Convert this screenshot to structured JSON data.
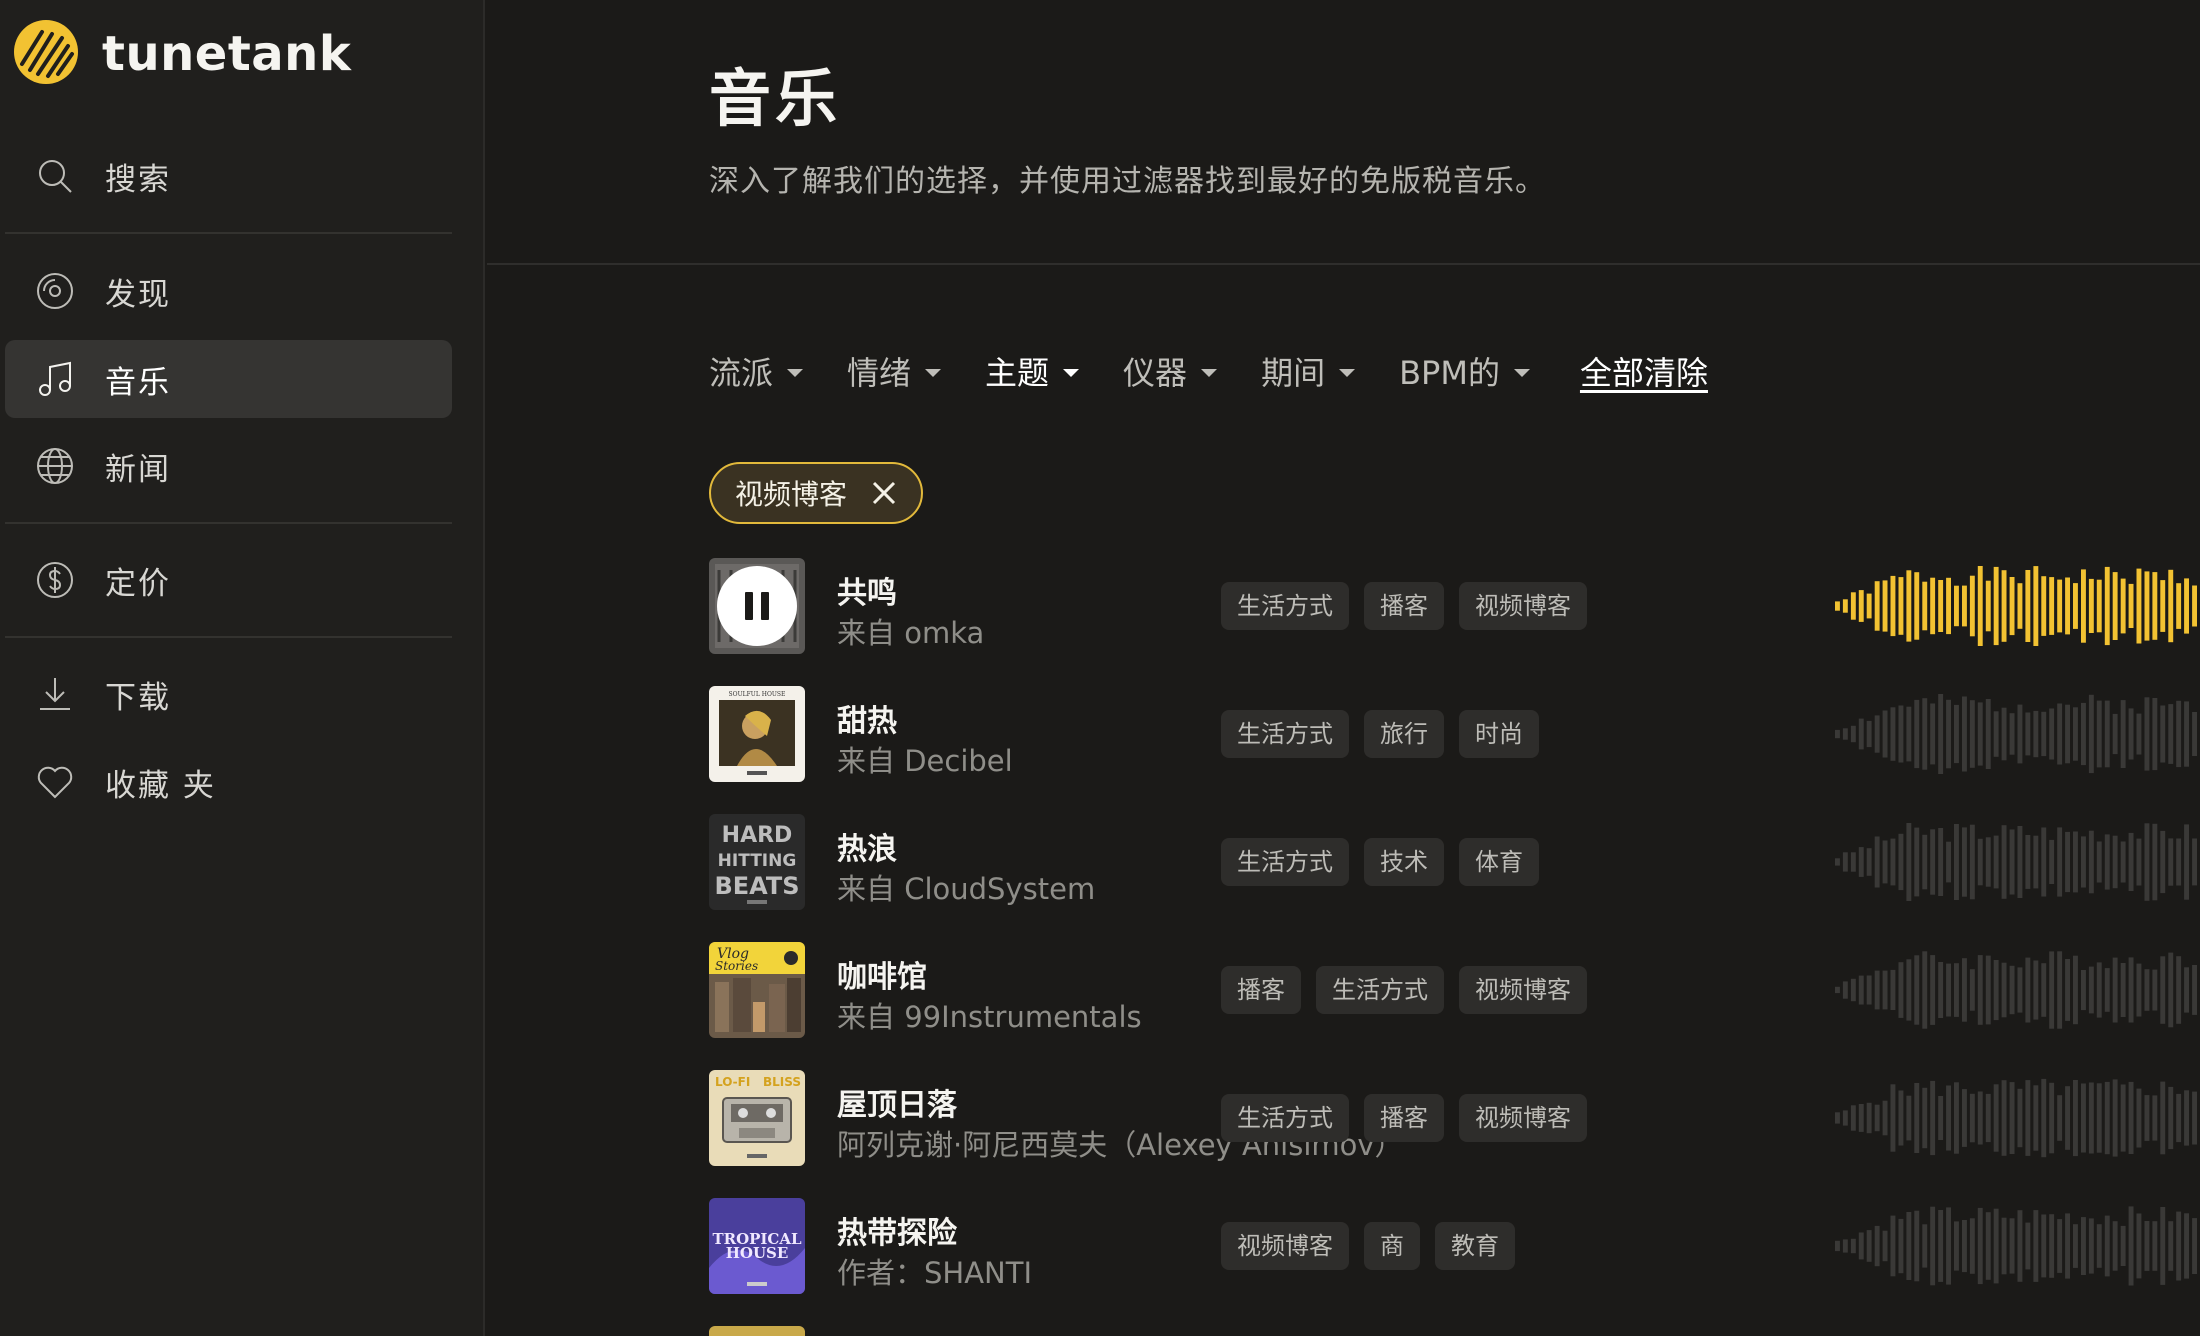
{
  "brand": {
    "name": "tunetank",
    "accent": "#f2c232"
  },
  "sidebar": {
    "items": [
      {
        "label": "搜索",
        "icon": "search-icon",
        "active": false
      },
      {
        "label": "发现",
        "icon": "disc-icon",
        "active": false
      },
      {
        "label": "音乐",
        "icon": "music-note-icon",
        "active": true
      },
      {
        "label": "新闻",
        "icon": "globe-icon",
        "active": false
      },
      {
        "label": "定价",
        "icon": "dollar-icon",
        "active": false
      },
      {
        "label": "下载",
        "icon": "download-icon",
        "active": false
      },
      {
        "label": "收藏 夹",
        "icon": "heart-icon",
        "active": false
      }
    ]
  },
  "header": {
    "title": "音乐",
    "subtitle": "深入了解我们的选择，并使用过滤器找到最好的免版税音乐。"
  },
  "filters": {
    "items": [
      {
        "label": "流派",
        "active": false
      },
      {
        "label": "情绪",
        "active": false
      },
      {
        "label": "主题",
        "active": true
      },
      {
        "label": "仪器",
        "active": false
      },
      {
        "label": "期间",
        "active": false
      },
      {
        "label": "BPM的",
        "active": false
      }
    ],
    "clear_all": "全部清除"
  },
  "active_filter_chip": {
    "label": "视频博客"
  },
  "tracks": [
    {
      "title": "共鸣",
      "artist": "来自 omka",
      "tags": [
        "生活方式",
        "播客",
        "视频博客"
      ],
      "playing": true
    },
    {
      "title": "甜热",
      "artist": "来自 Decibel",
      "tags": [
        "生活方式",
        "旅行",
        "时尚"
      ],
      "playing": false
    },
    {
      "title": "热浪",
      "artist": "来自 CloudSystem",
      "tags": [
        "生活方式",
        "技术",
        "体育"
      ],
      "playing": false
    },
    {
      "title": "咖啡馆",
      "artist": "来自 99Instrumentals",
      "tags": [
        "播客",
        "生活方式",
        "视频博客"
      ],
      "playing": false
    },
    {
      "title": "屋顶日落",
      "artist": "阿列克谢·阿尼西莫夫（Alexey Anisimov）",
      "tags": [
        "生活方式",
        "播客",
        "视频博客"
      ],
      "playing": false
    },
    {
      "title": "热带探险",
      "artist": "作者：SHANTI",
      "tags": [
        "视频博客",
        "商",
        "教育"
      ],
      "playing": false
    }
  ],
  "cover_art_text": {
    "track_2": "SOULFUL HOUSE",
    "track_3": [
      "HARD",
      "HITTING",
      "BEATS"
    ],
    "track_4": [
      "Vlog",
      "Stories"
    ],
    "track_5": [
      "LO-FI",
      "BLISS"
    ],
    "track_6": [
      "TROPICAL",
      "HOUSE"
    ]
  }
}
